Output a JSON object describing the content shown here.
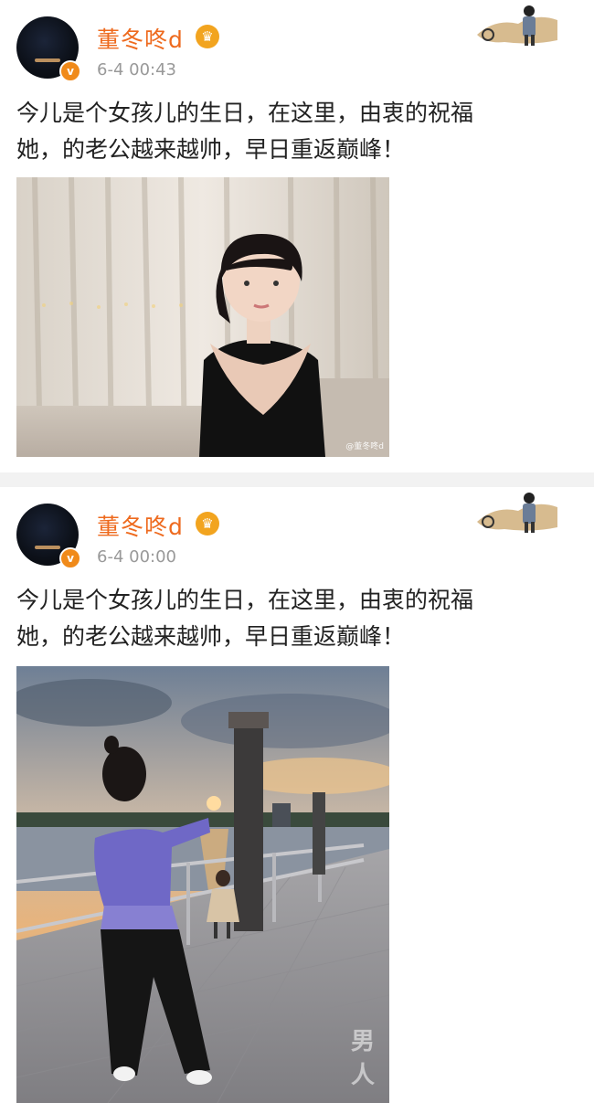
{
  "posts": [
    {
      "username": "董冬咚d",
      "time": "6-4 00:43",
      "text": "今儿是个女孩儿的生日，在这里，由衷的祝福\n她，的老公越来越帅，早日重返巅峰！",
      "photo_watermark": "@董冬咚d",
      "verified_badge": "v",
      "crown_icon": "crown-icon"
    },
    {
      "username": "董冬咚d",
      "time": "6-4 00:00",
      "text": "今儿是个女孩儿的生日，在这里，由衷的祝福\n她，的老公越来越帅，早日重返巅峰！",
      "photo_watermark": "男人",
      "verified_badge": "v",
      "crown_icon": "crown-icon"
    }
  ],
  "colors": {
    "username": "#ee6a1e",
    "time": "#999999",
    "badge": "#f08a1a",
    "separator": "#f2f2f2"
  }
}
